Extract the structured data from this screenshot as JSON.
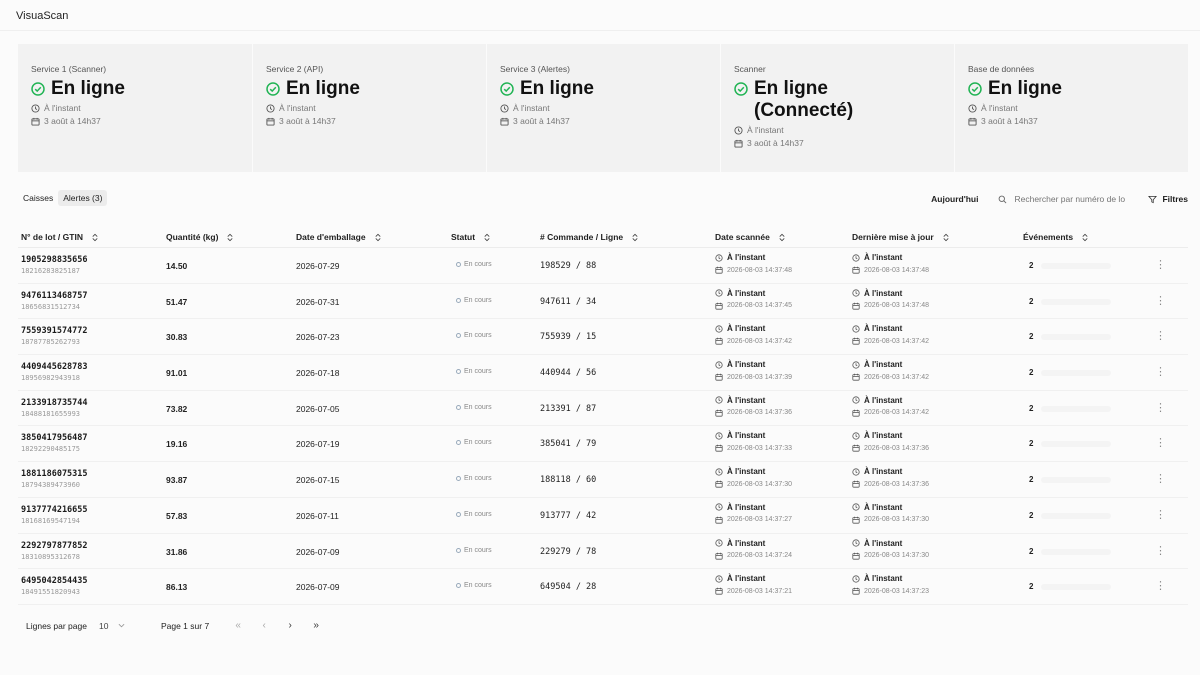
{
  "app": {
    "title": "VisuaScan"
  },
  "status_cards": [
    {
      "label": "Service 1 (Scanner)",
      "value": "En ligne",
      "time": "À l'instant",
      "date": "3 août à 14h37"
    },
    {
      "label": "Service 2 (API)",
      "value": "En ligne",
      "time": "À l'instant",
      "date": "3 août à 14h37"
    },
    {
      "label": "Service 3 (Alertes)",
      "value": "En ligne",
      "time": "À l'instant",
      "date": "3 août à 14h37"
    },
    {
      "label": "Scanner",
      "value": "En ligne (Connecté)",
      "time": "À l'instant",
      "date": "3 août à 14h37"
    },
    {
      "label": "Base de données",
      "value": "En ligne",
      "time": "À l'instant",
      "date": "3 août à 14h37"
    }
  ],
  "status_color": "#22b455",
  "toolbar": {
    "tabs": [
      "Caisses",
      "Alertes (3)"
    ],
    "active_tab": 1,
    "today_label": "Aujourd'hui",
    "search_placeholder": "Rechercher par numéro de lo",
    "filter_label": "Filtres"
  },
  "table": {
    "columns": [
      "N° de lot / GTIN",
      "Quantité (kg)",
      "Date d'emballage",
      "Statut",
      "# Commande / Ligne",
      "Date scannée",
      "Dernière mise à jour",
      "Événements"
    ],
    "rows": [
      {
        "lot": "1905298835656",
        "gtin": "18216283825187",
        "qty": "14.50",
        "pack_date": "2026-07-29",
        "status": "En cours",
        "order": "198529 / 88",
        "scan_rel": "À l'instant",
        "scan_ts": "2026-08-03 14:37:48",
        "upd_rel": "À l'instant",
        "upd_ts": "2026-08-03 14:37:48",
        "events": "2"
      },
      {
        "lot": "9476113468757",
        "gtin": "18656831512734",
        "qty": "51.47",
        "pack_date": "2026-07-31",
        "status": "En cours",
        "order": "947611 / 34",
        "scan_rel": "À l'instant",
        "scan_ts": "2026-08-03 14:37:45",
        "upd_rel": "À l'instant",
        "upd_ts": "2026-08-03 14:37:48",
        "events": "2"
      },
      {
        "lot": "7559391574772",
        "gtin": "18787785262793",
        "qty": "30.83",
        "pack_date": "2026-07-23",
        "status": "En cours",
        "order": "755939 / 15",
        "scan_rel": "À l'instant",
        "scan_ts": "2026-08-03 14:37:42",
        "upd_rel": "À l'instant",
        "upd_ts": "2026-08-03 14:37:42",
        "events": "2"
      },
      {
        "lot": "4409445628783",
        "gtin": "18956982943918",
        "qty": "91.01",
        "pack_date": "2026-07-18",
        "status": "En cours",
        "order": "440944 / 56",
        "scan_rel": "À l'instant",
        "scan_ts": "2026-08-03 14:37:39",
        "upd_rel": "À l'instant",
        "upd_ts": "2026-08-03 14:37:42",
        "events": "2"
      },
      {
        "lot": "2133918735744",
        "gtin": "18488181655993",
        "qty": "73.82",
        "pack_date": "2026-07-05",
        "status": "En cours",
        "order": "213391 / 87",
        "scan_rel": "À l'instant",
        "scan_ts": "2026-08-03 14:37:36",
        "upd_rel": "À l'instant",
        "upd_ts": "2026-08-03 14:37:42",
        "events": "2"
      },
      {
        "lot": "3850417956487",
        "gtin": "18292290485175",
        "qty": "19.16",
        "pack_date": "2026-07-19",
        "status": "En cours",
        "order": "385041 / 79",
        "scan_rel": "À l'instant",
        "scan_ts": "2026-08-03 14:37:33",
        "upd_rel": "À l'instant",
        "upd_ts": "2026-08-03 14:37:36",
        "events": "2"
      },
      {
        "lot": "1881186075315",
        "gtin": "18794389473960",
        "qty": "93.87",
        "pack_date": "2026-07-15",
        "status": "En cours",
        "order": "188118 / 60",
        "scan_rel": "À l'instant",
        "scan_ts": "2026-08-03 14:37:30",
        "upd_rel": "À l'instant",
        "upd_ts": "2026-08-03 14:37:36",
        "events": "2"
      },
      {
        "lot": "9137774216655",
        "gtin": "18168169547194",
        "qty": "57.83",
        "pack_date": "2026-07-11",
        "status": "En cours",
        "order": "913777 / 42",
        "scan_rel": "À l'instant",
        "scan_ts": "2026-08-03 14:37:27",
        "upd_rel": "À l'instant",
        "upd_ts": "2026-08-03 14:37:30",
        "events": "2"
      },
      {
        "lot": "2292797877852",
        "gtin": "18310895312678",
        "qty": "31.86",
        "pack_date": "2026-07-09",
        "status": "En cours",
        "order": "229279 / 78",
        "scan_rel": "À l'instant",
        "scan_ts": "2026-08-03 14:37:24",
        "upd_rel": "À l'instant",
        "upd_ts": "2026-08-03 14:37:30",
        "events": "2"
      },
      {
        "lot": "6495042854435",
        "gtin": "18491551820943",
        "qty": "86.13",
        "pack_date": "2026-07-09",
        "status": "En cours",
        "order": "649504 / 28",
        "scan_rel": "À l'instant",
        "scan_ts": "2026-08-03 14:37:21",
        "upd_rel": "À l'instant",
        "upd_ts": "2026-08-03 14:37:23",
        "events": "2"
      }
    ]
  },
  "pagination": {
    "rows_label": "Lignes par page",
    "rows_value": "10",
    "page_label": "Page 1 sur 7",
    "first": "«",
    "prev": "‹",
    "next": "›",
    "last": "»"
  }
}
